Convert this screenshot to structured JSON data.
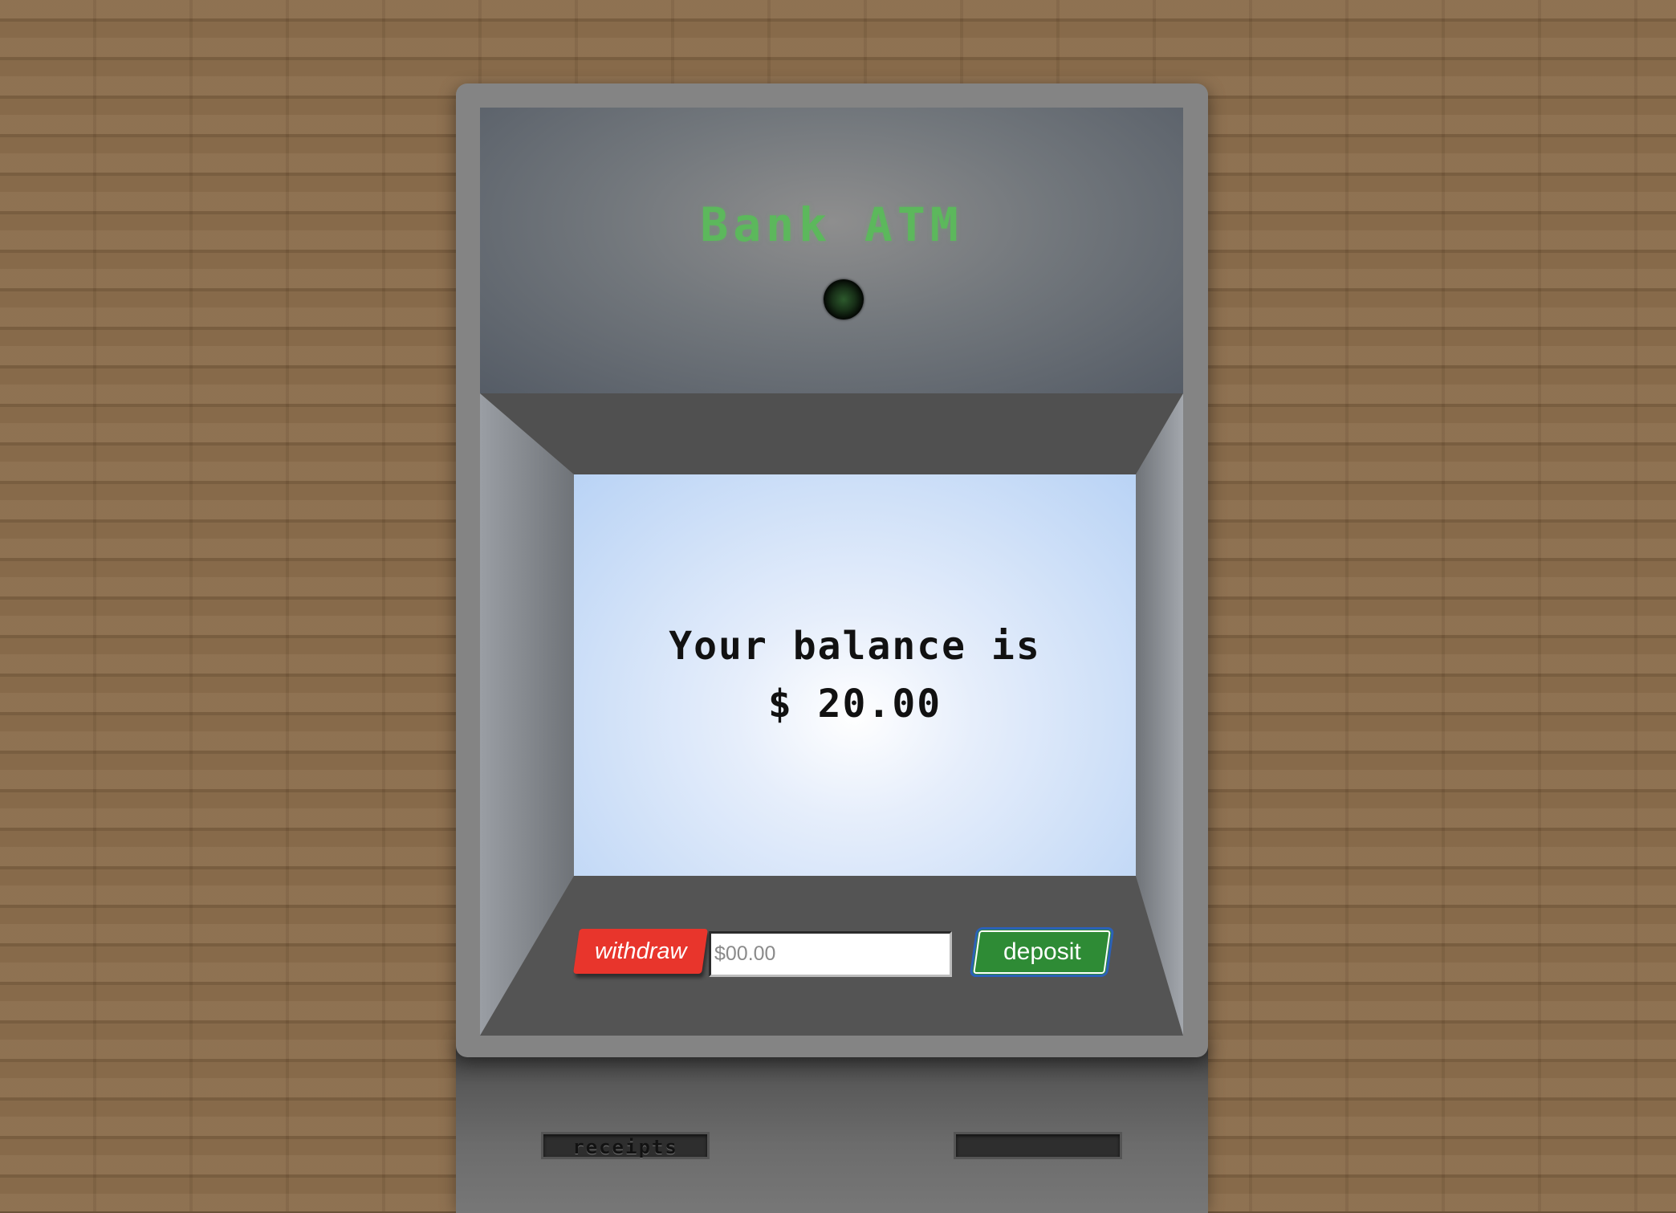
{
  "atm": {
    "title": "Bank ATM",
    "screen": {
      "line1": "Your balance is",
      "line2": "$ 20.00"
    },
    "controls": {
      "withdraw_label": "withdraw",
      "deposit_label": "deposit",
      "amount_placeholder": "$00.00",
      "amount_value": ""
    },
    "slots": {
      "receipts_label": "receipts"
    }
  },
  "colors": {
    "wall": "#8b6d4c",
    "title_green": "#5cb85c",
    "withdraw_red": "#e8352c",
    "deposit_green": "#2e8b35",
    "deposit_border": "#2b61b8",
    "screen_blue": "#b9d3f5"
  },
  "icons": {
    "camera": "camera-lens-icon"
  }
}
